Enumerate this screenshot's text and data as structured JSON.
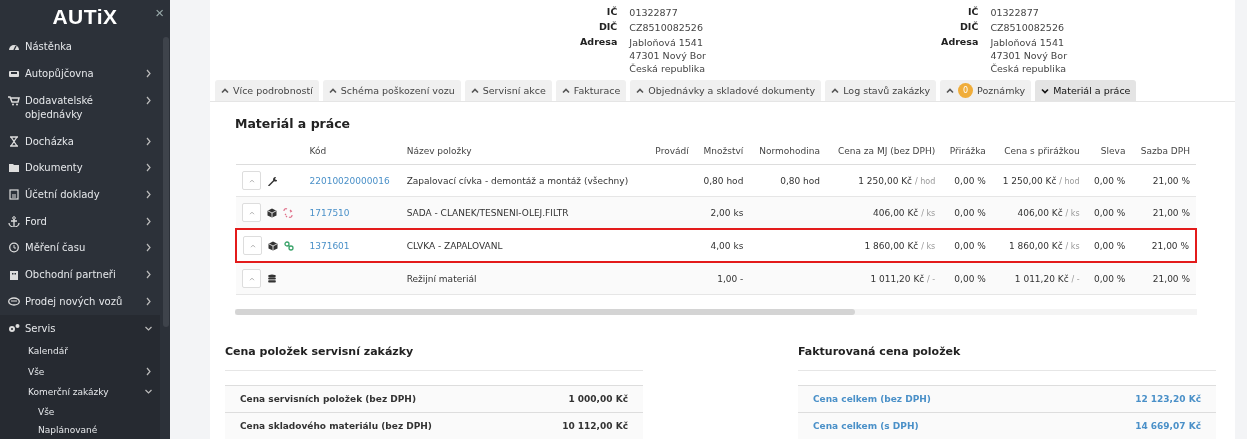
{
  "sidebar": {
    "logo": "AUTiX",
    "close": "×",
    "items": [
      {
        "label": "Nástěnka",
        "arrow": false
      },
      {
        "label": "Autopůjčovna",
        "arrow": true
      },
      {
        "label": "Dodavatelské objednávky",
        "arrow": true
      },
      {
        "label": "Docházka",
        "arrow": true
      },
      {
        "label": "Dokumenty",
        "arrow": true
      },
      {
        "label": "Účetní doklady",
        "arrow": true
      },
      {
        "label": "Ford",
        "arrow": true
      },
      {
        "label": "Měření času",
        "arrow": true
      },
      {
        "label": "Obchodní partneři",
        "arrow": true
      },
      {
        "label": "Prodej nových vozů",
        "arrow": true
      },
      {
        "label": "Servis",
        "arrow": true,
        "expanded": true,
        "children": [
          {
            "label": "Kalendář",
            "arrow": false
          },
          {
            "label": "Vše",
            "arrow": true,
            "expanded": false
          },
          {
            "label": "Komerční zakázky",
            "arrow": true,
            "expanded": true,
            "children": [
              {
                "label": "Vše"
              },
              {
                "label": "Naplánované"
              }
            ]
          }
        ]
      }
    ]
  },
  "parties": [
    {
      "fields": [
        {
          "label": "IČ",
          "lines": [
            "01322877"
          ]
        },
        {
          "label": "DIČ",
          "lines": [
            "CZ8510082526"
          ]
        },
        {
          "label": "Adresa",
          "lines": [
            "Jabloňová 1541",
            "47301 Nový Bor",
            "Česká republika"
          ]
        }
      ]
    },
    {
      "fields": [
        {
          "label": "IČ",
          "lines": [
            "01322877"
          ]
        },
        {
          "label": "DIČ",
          "lines": [
            "CZ8510082526"
          ]
        },
        {
          "label": "Adresa",
          "lines": [
            "Jabloňová 1541",
            "47301 Nový Bor",
            "Česká republika"
          ]
        }
      ]
    }
  ],
  "tabs": [
    {
      "label": "Více podrobností",
      "selected": false
    },
    {
      "label": "Schéma poškození vozu",
      "selected": false
    },
    {
      "label": "Servisní akce",
      "selected": false
    },
    {
      "label": "Fakturace",
      "selected": false
    },
    {
      "label": "Objednávky a skladové dokumenty",
      "selected": false
    },
    {
      "label": "Log stavů zakázky",
      "selected": false
    },
    {
      "label": "Poznámky",
      "badge": "0",
      "selected": false
    },
    {
      "label": "Materiál a práce",
      "selected": true
    }
  ],
  "section": {
    "title": "Materiál a práce",
    "columns": [
      "Kód",
      "Název položky",
      "Provádí",
      "Množství",
      "Normohodina",
      "Cena za MJ (bez DPH)",
      "Přirážka",
      "Cena s přirážkou",
      "Sleva",
      "Sazba DPH"
    ],
    "rows": [
      {
        "kind": "labor",
        "code": "22010020000016",
        "name": "Zapalovací cívka - demontáž a montáž (všechny)",
        "qty": "0,80 hod",
        "norm": "0,80 hod",
        "price": "1 250,00 Kč",
        "price_unit": "/ hod",
        "markup": "0,00 %",
        "price_markup": "1 250,00 Kč",
        "price_markup_unit": "/ hod",
        "discount": "0,00 %",
        "vat": "21,00 %",
        "highlighted": false
      },
      {
        "kind": "part",
        "linked": false,
        "code": "1717510",
        "name": "SADA - CLANEK/TESNENI-OLEJ.FILTR",
        "qty": "2,00 ks",
        "price": "406,00 Kč",
        "price_unit": "/ ks",
        "markup": "0,00 %",
        "price_markup": "406,00 Kč",
        "price_markup_unit": "/ ks",
        "discount": "0,00 %",
        "vat": "21,00 %",
        "highlighted": false
      },
      {
        "kind": "part",
        "linked": true,
        "code": "1371601",
        "name": "CLVKA - ZAPALOVANL",
        "qty": "4,00 ks",
        "price": "1 860,00 Kč",
        "price_unit": "/ ks",
        "markup": "0,00 %",
        "price_markup": "1 860,00 Kč",
        "price_markup_unit": "/ ks",
        "discount": "0,00 %",
        "vat": "21,00 %",
        "highlighted": true
      },
      {
        "kind": "overhead",
        "name": "Režijní materiál",
        "qty": "1,00 -",
        "price": "1 011,20 Kč",
        "price_unit": "/ -",
        "markup": "0,00 %",
        "price_markup": "1 011,20 Kč",
        "price_markup_unit": "/ -",
        "discount": "0,00 %",
        "vat": "21,00 %",
        "highlighted": false
      }
    ]
  },
  "summaries": [
    {
      "title": "Cena položek servisní zakázky",
      "link": false,
      "rows": [
        {
          "label": "Cena servisních položek (bez DPH)",
          "value": "1 000,00 Kč"
        },
        {
          "label": "Cena skladového materiálu (bez DPH)",
          "value": "10 112,00 Kč"
        }
      ]
    },
    {
      "title": "Fakturovaná cena položek",
      "link": true,
      "rows": [
        {
          "label": "Cena celkem (bez DPH)",
          "value": "12 123,20 Kč"
        },
        {
          "label": "Cena celkem (s DPH)",
          "value": "14 669,07 Kč"
        }
      ]
    }
  ]
}
